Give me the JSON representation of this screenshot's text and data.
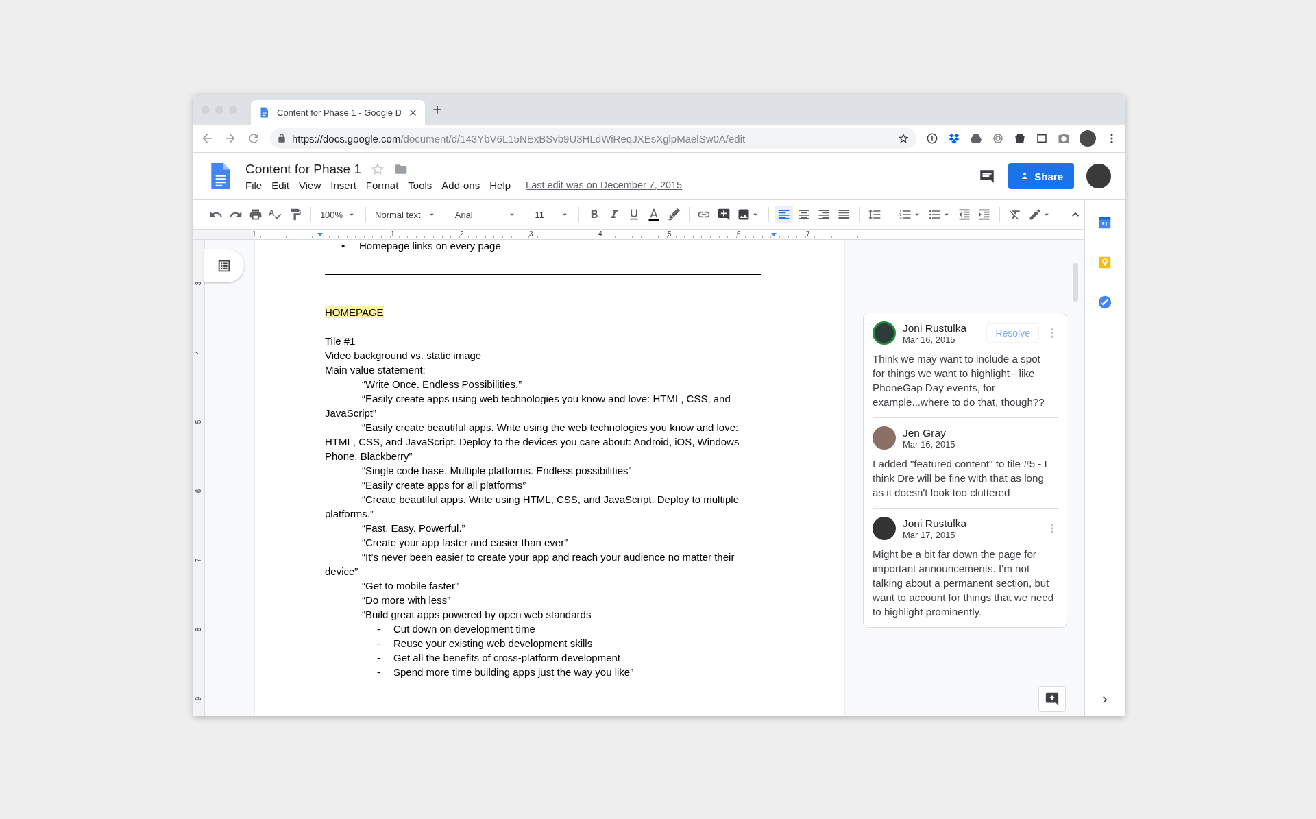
{
  "browser": {
    "tab": {
      "title": "Content for Phase 1 - Google D"
    },
    "address": {
      "host": "https://docs.google.com",
      "path": "/document/d/143YbV6L15NExBSvb9U3HLdWiReqJXEsXglpMaelSw0A/edit"
    }
  },
  "doc_header": {
    "title": "Content for Phase 1",
    "menu": [
      "File",
      "Edit",
      "View",
      "Insert",
      "Format",
      "Tools",
      "Add-ons",
      "Help"
    ],
    "last_edit": "Last edit was on December 7, 2015",
    "share_label": "Share"
  },
  "toolbar": {
    "zoom": "100%",
    "style": "Normal text",
    "font": "Arial",
    "size": "11",
    "alignment": [
      {
        "selected": true
      },
      {
        "selected": false
      },
      {
        "selected": false
      },
      {
        "selected": false
      }
    ]
  },
  "ruler": {
    "horizontal": [
      "1",
      "1",
      "2",
      "3",
      "4",
      "5",
      "6",
      "7"
    ],
    "vertical": [
      "3",
      "4",
      "5",
      "6",
      "7",
      "8",
      "9"
    ]
  },
  "document": {
    "paragraphs": [
      {
        "kind": "bullet",
        "marker": "•",
        "text": "Homepage links on every page"
      },
      {
        "kind": "rule"
      },
      {
        "kind": "highlight",
        "text": "HOMEPAGE"
      },
      {
        "kind": "text",
        "text": "Tile #1"
      },
      {
        "kind": "text",
        "text": "Video background vs. static image"
      },
      {
        "kind": "text",
        "text": "Main value statement:"
      },
      {
        "kind": "quote",
        "text": "“Write Once. Endless Possibilities.”"
      },
      {
        "kind": "quote",
        "text": "“Easily create apps using web technologies you know and love: HTML, CSS, and JavaScript”"
      },
      {
        "kind": "quote",
        "text": "“Easily create beautiful apps. Write using the web technologies you know and love: HTML, CSS, and JavaScript. Deploy to the devices you care about: Android, iOS, Windows Phone, Blackberry”"
      },
      {
        "kind": "quote",
        "text": "“Single code base. Multiple platforms. Endless possibilities”"
      },
      {
        "kind": "quote",
        "text": "“Easily create apps for all platforms”"
      },
      {
        "kind": "quote",
        "text": "“Create beautiful apps. Write using HTML, CSS, and JavaScript. Deploy to multiple platforms.”"
      },
      {
        "kind": "quote",
        "text": "“Fast. Easy. Powerful.”"
      },
      {
        "kind": "quote",
        "text": "“Create your app faster and easier than ever”"
      },
      {
        "kind": "quote",
        "text": "“It’s never been easier to create your app and reach your audience no matter their device”"
      },
      {
        "kind": "quote",
        "text": "“Get to mobile faster”"
      },
      {
        "kind": "quote",
        "text": "“Do more with less”"
      },
      {
        "kind": "quote",
        "text": "“Build great apps powered by open web standards"
      },
      {
        "kind": "dash",
        "marker": "-",
        "text": "Cut down on development time"
      },
      {
        "kind": "dash",
        "marker": "-",
        "text": "Reuse your existing web development skills"
      },
      {
        "kind": "dash",
        "marker": "-",
        "text": "Get all the benefits of cross-platform development"
      },
      {
        "kind": "dash",
        "marker": "-",
        "text": "Spend more time building apps just the way you like”"
      }
    ]
  },
  "comments": [
    {
      "author": "Joni Rustulka",
      "date": "Mar 16, 2015",
      "text": "Think we may want to include a spot for things we want to highlight - like PhoneGap Day events, for example...where to do that, though??",
      "selected": true,
      "resolve_label": "Resolve",
      "menu_icon": true
    },
    {
      "author": "Jen Gray",
      "date": "Mar 16, 2015",
      "text": "I added \"featured content\" to tile #5 - I think Dre will be fine with that as long as it doesn't look too cluttered",
      "selected": false,
      "menu_icon": false
    },
    {
      "author": "Joni Rustulka",
      "date": "Mar 17, 2015",
      "text": "Might be a bit far down the page for important announcements. I'm not talking about a permanent section, but want to account for things that we need to highlight prominently.",
      "selected": false,
      "menu_icon": true
    }
  ]
}
